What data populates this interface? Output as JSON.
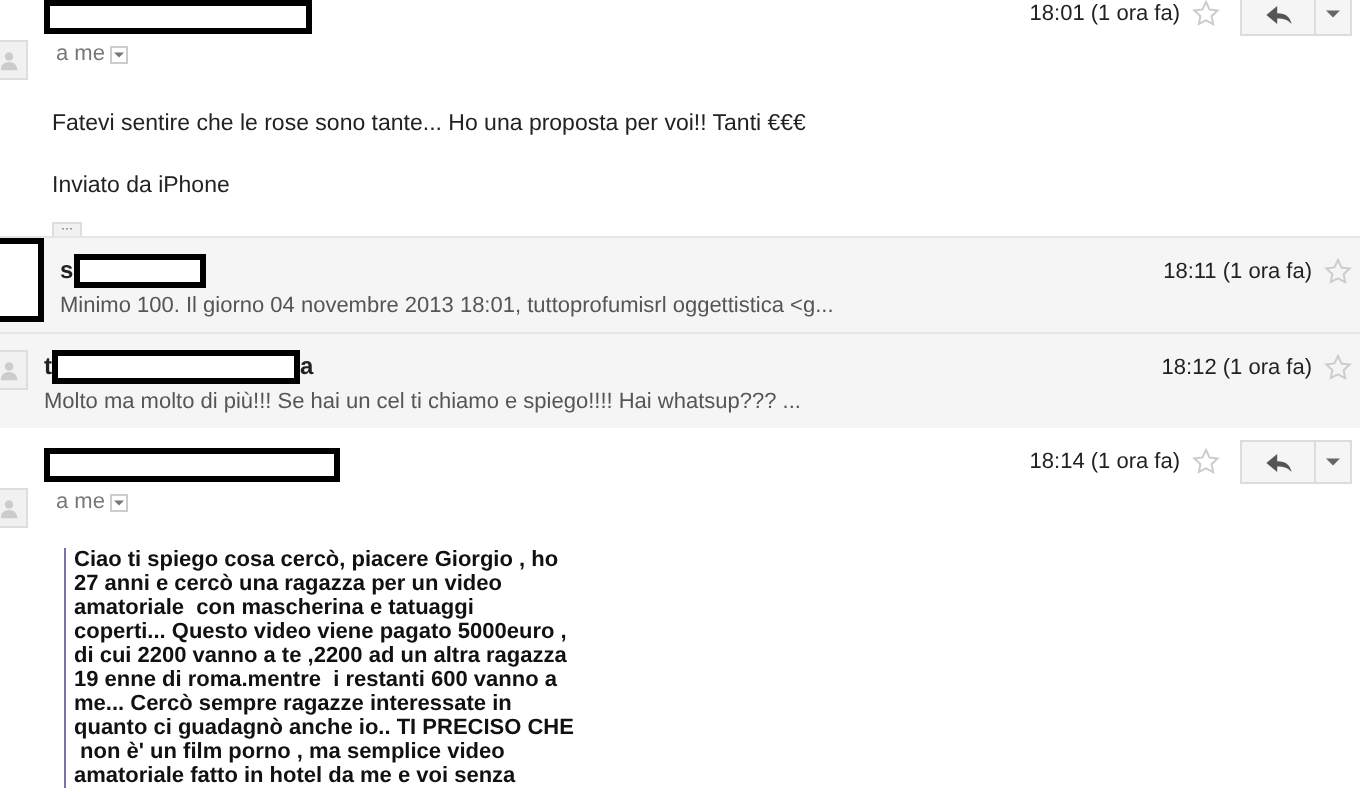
{
  "messages": [
    {
      "kind": "expanded",
      "avatar_redacted": false,
      "sender": [
        {
          "kind": "redacted"
        }
      ],
      "recipient": "a me",
      "time": "18:01 (1 ora fa)",
      "starred": false,
      "body": [
        "Fatevi sentire che le rose sono tante... Ho una proposta per voi!!  Tanti €€€",
        "Inviato da iPhone"
      ],
      "more": "···"
    },
    {
      "kind": "collapsed",
      "avatar_redacted": true,
      "sender": [
        {
          "kind": "text",
          "text": "s"
        },
        {
          "kind": "redacted"
        }
      ],
      "time": "18:11 (1 ora fa)",
      "starred": false,
      "snippet": "Minimo 100. Il giorno 04 novembre 2013 18:01, tuttoprofumisrl oggettistica <g..."
    },
    {
      "kind": "collapsed",
      "avatar_redacted": false,
      "sender": [
        {
          "kind": "text",
          "text": "t"
        },
        {
          "kind": "redacted"
        },
        {
          "kind": "text",
          "text": "a"
        }
      ],
      "time": "18:12 (1 ora fa)",
      "starred": false,
      "snippet": "Molto ma molto di più!!! Se hai un cel ti chiamo e spiego!!!! Hai whatsup??? ..."
    },
    {
      "kind": "expanded",
      "avatar_redacted": false,
      "sender": [
        {
          "kind": "redacted"
        }
      ],
      "recipient": "a me",
      "time": "18:14 (1 ora fa)",
      "starred": false,
      "quote": [
        "Ciao ti spiego cosa cercò, piacere Giorgio , ho",
        "27 anni e cercò una ragazza per un video",
        "amatoriale  con mascherina e tatuaggi",
        "coperti... Questo video viene pagato 5000euro ,",
        "di cui 2200 vanno a te ,2200 ad un altra ragazza",
        "19 enne di roma.mentre  i restanti 600 vanno a",
        "me... Cercò sempre ragazze interessate in",
        "quanto ci guadagnò anche io.. TI PRECISO CHE",
        " non è' un film porno , ma semplice video",
        "amatoriale fatto in hotel da me e voi senza"
      ]
    }
  ]
}
